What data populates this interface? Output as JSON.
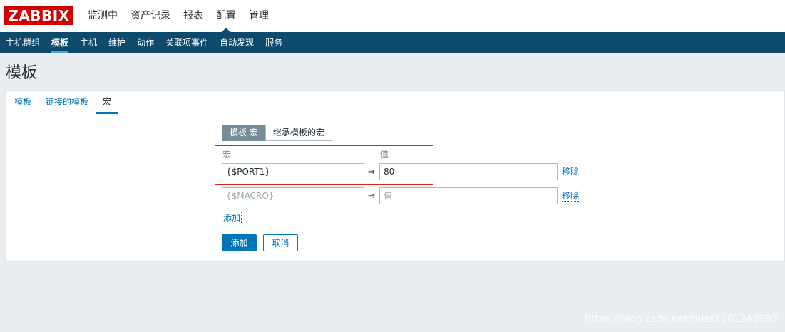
{
  "app": {
    "logo": "ZABBIX"
  },
  "main_nav": [
    "监测中",
    "资产记录",
    "报表",
    "配置",
    "管理"
  ],
  "sub_nav": [
    "主机群组",
    "模板",
    "主机",
    "维护",
    "动作",
    "关联项事件",
    "自动发现",
    "服务"
  ],
  "page_title": "模板",
  "tabs": [
    "模板",
    "链接的模板",
    "宏"
  ],
  "macro_toggle": {
    "own": "模板 宏",
    "inherited": "继承模板的宏"
  },
  "columns": {
    "macro": "宏",
    "value": "值"
  },
  "macros": [
    {
      "macro": "{$PORT1}",
      "value": "80",
      "remove": "移除"
    }
  ],
  "new_row": {
    "macro_placeholder": "{$MACRO}",
    "value_placeholder": "值",
    "arrow": "⇒",
    "remove": "移除"
  },
  "arrow": "⇒",
  "add_link": "添加",
  "buttons": {
    "add": "添加",
    "cancel": "取消"
  },
  "watermark": "https://blog.csdn.net/miss1181248983",
  "colors": {
    "brand": "#d40000",
    "nav_dark": "#0e4a6c",
    "link": "#0275b8"
  }
}
